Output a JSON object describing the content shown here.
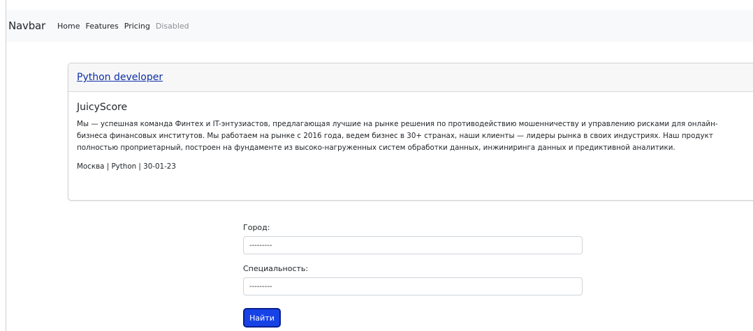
{
  "navbar": {
    "brand": "Navbar",
    "links": [
      {
        "label": "Home",
        "state": "active"
      },
      {
        "label": "Features",
        "state": "normal"
      },
      {
        "label": "Pricing",
        "state": "normal"
      },
      {
        "label": "Disabled",
        "state": "disabled"
      }
    ]
  },
  "vacancy": {
    "title": "Python developer",
    "company": "JuicyScore",
    "description": "Мы — успешная команда Финтех и IT-энтузиастов, предлагающая лучшие на рынке решения по противодействию мошенничеству и управлению рисками для онлайн-бизнеса финансовых институтов. Мы работаем на рынке с 2016 года, ведем бизнес в 30+ странах, наши клиенты — лидеры рынка в своих индустриях. Наш продукт полностью проприетарный, построен на фундаменте из высоко-нагруженных систем обработки данных, инжиниринга данных и предиктивной аналитики.",
    "meta": "Москва | Python | 30-01-23"
  },
  "filter": {
    "city_label": "Город:",
    "city_value": "---------",
    "specialty_label": "Специальность:",
    "specialty_value": "---------",
    "submit_label": "Найти"
  },
  "colors": {
    "navbar_bg": "#f8f9fa",
    "link": "#0d2fa8",
    "button": "#1743e6"
  }
}
